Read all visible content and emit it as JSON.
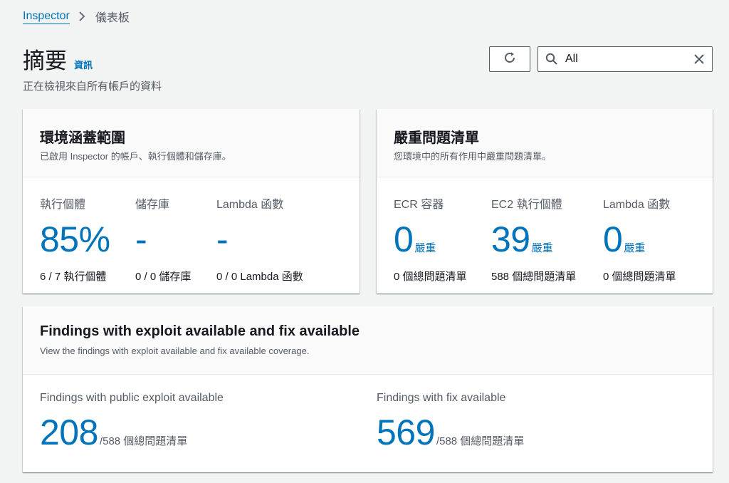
{
  "breadcrumb": {
    "parent": "Inspector",
    "current": "儀表板"
  },
  "header": {
    "title": "摘要",
    "info_link": "資訊",
    "description": "正在檢視來自所有帳戶的資料"
  },
  "toolbar": {
    "refresh_icon": "refresh-icon",
    "filter": {
      "value": "All",
      "search_icon": "search-icon",
      "clear_icon": "close-icon"
    }
  },
  "coverage": {
    "title": "環境涵蓋範圍",
    "subtitle": "已啟用 Inspector 的帳戶、執行個體和儲存庫。",
    "metrics": [
      {
        "label": "執行個體",
        "value": "85%",
        "sub": "6 / 7 執行個體"
      },
      {
        "label": "儲存庫",
        "value": "-",
        "sub": "0 / 0 儲存庫"
      },
      {
        "label": "Lambda 函數",
        "value": "-",
        "sub": "0 / 0 Lambda 函數"
      }
    ]
  },
  "critical": {
    "title": "嚴重問題清單",
    "subtitle": "您環境中的所有作用中嚴重問題清單。",
    "metrics": [
      {
        "label": "ECR 容器",
        "value": "0",
        "unit": "嚴重",
        "sub": "0 個總問題清單"
      },
      {
        "label": "EC2 執行個體",
        "value": "39",
        "unit": "嚴重",
        "sub": "588 個總問題清單"
      },
      {
        "label": "Lambda 函數",
        "value": "0",
        "unit": "嚴重",
        "sub": "0 個總問題清單"
      }
    ]
  },
  "exploit": {
    "title": "Findings with exploit available and fix available",
    "subtitle": "View the findings with exploit available and fix available coverage.",
    "metrics": [
      {
        "label": "Findings with public exploit available",
        "value": "208",
        "suffix": "/588 個總問題清單"
      },
      {
        "label": "Findings with fix available",
        "value": "569",
        "suffix": "/588 個總問題清單"
      }
    ]
  },
  "colors": {
    "accent": "#0073bb",
    "background": "#f2f3f3",
    "text": "#16191f",
    "muted": "#545b64"
  }
}
